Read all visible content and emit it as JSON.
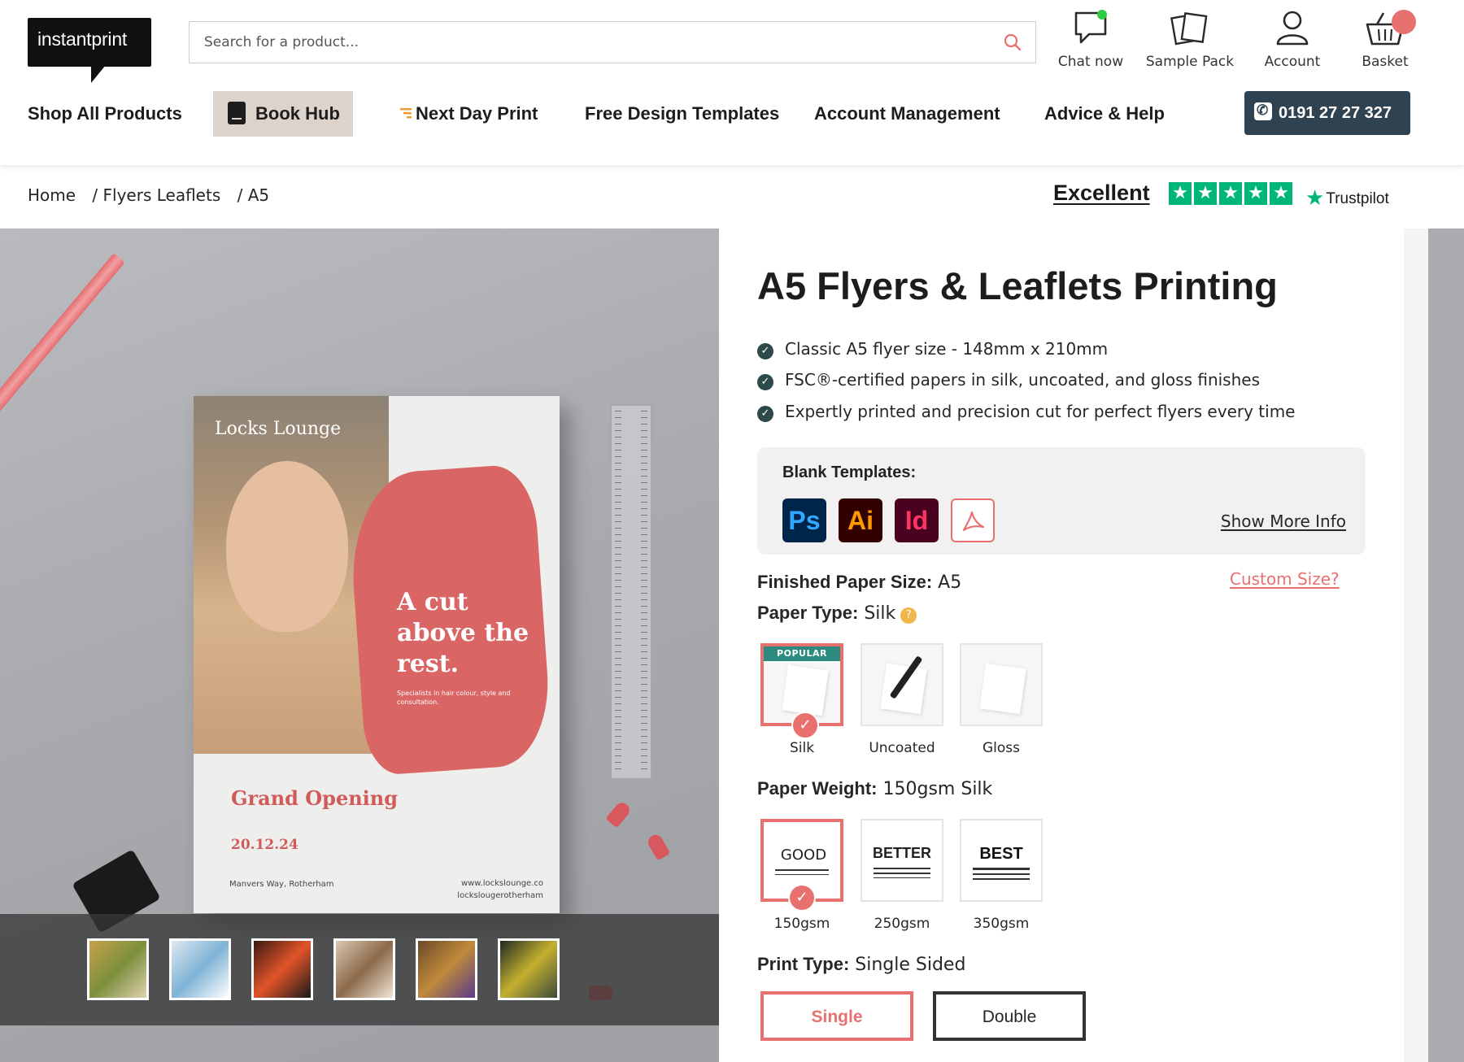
{
  "header": {
    "logo_text": "instantprint",
    "search_placeholder": "Search for a product...",
    "icons": {
      "chat": "Chat now",
      "sample": "Sample Pack",
      "account": "Account",
      "basket": "Basket"
    }
  },
  "nav": {
    "shop_all": "Shop All Products",
    "book_hub": "Book Hub",
    "next_day": "Next Day Print",
    "free_templates": "Free Design Templates",
    "account_mgmt": "Account Management",
    "advice": "Advice & Help",
    "phone": "0191 27 27 327"
  },
  "breadcrumb": {
    "home": "Home",
    "category": "/ Flyers Leaflets",
    "current": "/ A5"
  },
  "trustpilot": {
    "rating_word": "Excellent",
    "stars": 5,
    "brand": "Trustpilot"
  },
  "hero_flyer": {
    "brand": "Locks Lounge",
    "tagline": "A cut above the rest.",
    "subline": "Specialists in hair colour, style and consultation.",
    "event": "Grand Opening",
    "date": "20.12.24",
    "address": "Manvers Way, Rotherham",
    "web": "www.lockslounge.co",
    "social": "lockslougerotherham"
  },
  "product": {
    "title": "A5 Flyers & Leaflets Printing",
    "features": [
      "Classic A5 flyer size - 148mm x 210mm",
      "FSC®-certified papers in silk, uncoated, and gloss finishes",
      "Expertly printed and precision cut for perfect flyers every time"
    ],
    "templates": {
      "title": "Blank Templates:",
      "ps": "Ps",
      "ai": "Ai",
      "id": "Id",
      "show_more": "Show More Info"
    },
    "finished_size": {
      "label": "Finished Paper Size:",
      "value": "A5"
    },
    "custom_size": "Custom Size?",
    "paper_type": {
      "label": "Paper Type:",
      "value": "Silk",
      "popular_badge": "POPULAR",
      "options": [
        "Silk",
        "Uncoated",
        "Gloss"
      ]
    },
    "paper_weight": {
      "label": "Paper Weight:",
      "value": "150gsm Silk",
      "options": [
        {
          "tier": "GOOD",
          "weight": "150gsm"
        },
        {
          "tier": "BETTER",
          "weight": "250gsm"
        },
        {
          "tier": "BEST",
          "weight": "350gsm"
        }
      ]
    },
    "print_type": {
      "label": "Print Type:",
      "value": "Single Sided",
      "options": [
        "Single",
        "Double"
      ]
    }
  },
  "colors": {
    "accent": "#e8716f",
    "nav_dark": "#2f4251",
    "trustpilot_green": "#00b67a",
    "check_dark": "#2d4a4a"
  }
}
